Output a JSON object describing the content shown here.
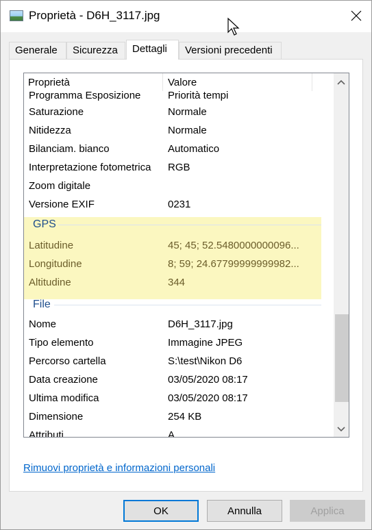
{
  "window": {
    "title": "Proprietà - D6H_3117.jpg"
  },
  "tabs": [
    {
      "label": "Generale"
    },
    {
      "label": "Sicurezza"
    },
    {
      "label": "Dettagli"
    },
    {
      "label": "Versioni precedenti"
    }
  ],
  "list": {
    "header": {
      "property": "Proprietà",
      "value": "Valore"
    },
    "rows_top": [
      {
        "name": "Programma Esposizione",
        "value": "Priorità tempi"
      },
      {
        "name": "Saturazione",
        "value": "Normale"
      },
      {
        "name": "Nitidezza",
        "value": "Normale"
      },
      {
        "name": "Bilanciam. bianco",
        "value": "Automatico"
      },
      {
        "name": "Interpretazione fotometrica",
        "value": "RGB"
      },
      {
        "name": "Zoom digitale",
        "value": ""
      },
      {
        "name": "Versione EXIF",
        "value": "0231"
      }
    ],
    "gps_group": {
      "title": "GPS",
      "rows": [
        {
          "name": "Latitudine",
          "value": "45; 45; 52.5480000000096..."
        },
        {
          "name": "Longitudine",
          "value": "8; 59; 24.67799999999982..."
        },
        {
          "name": "Altitudine",
          "value": "344"
        }
      ]
    },
    "file_group": {
      "title": "File",
      "rows": [
        {
          "name": "Nome",
          "value": "D6H_3117.jpg"
        },
        {
          "name": "Tipo elemento",
          "value": "Immagine JPEG"
        },
        {
          "name": "Percorso cartella",
          "value": "S:\\test\\Nikon D6"
        },
        {
          "name": "Data creazione",
          "value": "03/05/2020 08:17"
        },
        {
          "name": "Ultima modifica",
          "value": "03/05/2020 08:17"
        },
        {
          "name": "Dimensione",
          "value": "254 KB"
        },
        {
          "name": "Attributi",
          "value": "A"
        }
      ]
    }
  },
  "remove_link": "Rimuovi proprietà e informazioni personali",
  "buttons": {
    "ok": "OK",
    "cancel": "Annulla",
    "apply": "Applica"
  },
  "colors": {
    "accent": "#0078d7",
    "link": "#0066cc",
    "group_title": "#1e4e8c",
    "gps_highlight": "#fbf7c0"
  },
  "icons": {
    "title": "image-file-icon",
    "close": "close-icon",
    "scroll_up": "chevron-up-icon",
    "scroll_down": "chevron-down-icon"
  }
}
